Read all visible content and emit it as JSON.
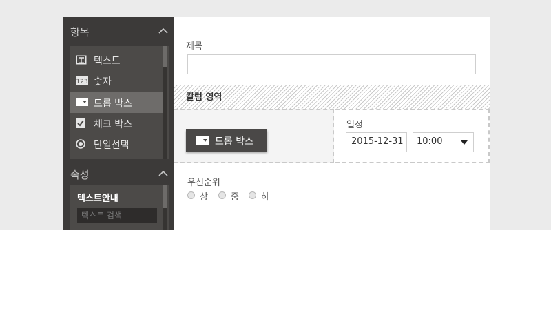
{
  "sidebar": {
    "items_section": {
      "title": "항목",
      "icon": "chevron-up-icon"
    },
    "items": [
      {
        "label": "텍스트",
        "icon": "text-field-icon"
      },
      {
        "label": "숫자",
        "icon": "number-field-icon",
        "icon_text": "123"
      },
      {
        "label": "드롭 박스",
        "icon": "dropdown-icon",
        "active": true
      },
      {
        "label": "체크 박스",
        "icon": "checkbox-icon"
      },
      {
        "label": "단일선택",
        "icon": "radio-icon"
      }
    ],
    "props_section": {
      "title": "속성",
      "icon": "chevron-up-icon"
    },
    "props": {
      "heading": "텍스트안내",
      "search_placeholder": "텍스트 검색"
    }
  },
  "form": {
    "title_label": "제목",
    "title_value": "",
    "column_area_label": "칼럼 영역",
    "dropbox_button": "드롭 박스",
    "schedule_label": "일정",
    "date_value": "2015-12-31",
    "time_value": "10:00",
    "priority_label": "우선순위",
    "priority_options": [
      "상",
      "중",
      "하"
    ]
  },
  "colors": {
    "sidebar_bg": "#3c3a39",
    "active_item": "#6e6c6a",
    "button_bg": "#4a4847"
  }
}
